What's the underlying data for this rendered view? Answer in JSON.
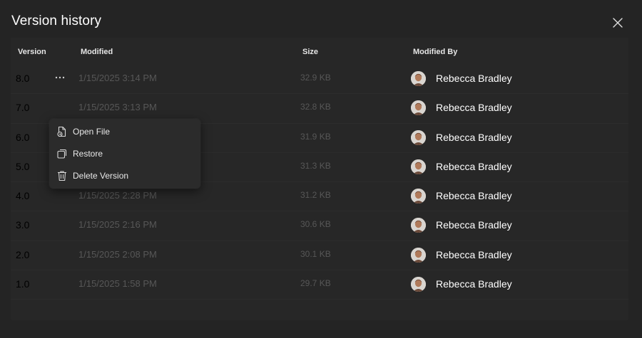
{
  "dialog": {
    "title": "Version history",
    "close_icon": "close-icon"
  },
  "table": {
    "columns": {
      "version": "Version",
      "modified": "Modified",
      "size": "Size",
      "modified_by": "Modified By"
    },
    "rows": [
      {
        "version": "8.0",
        "modified": "1/15/2025 3:14 PM",
        "size": "32.9 KB",
        "modified_by": "Rebecca Bradley"
      },
      {
        "version": "7.0",
        "modified": "1/15/2025 3:13 PM",
        "size": "32.8 KB",
        "modified_by": "Rebecca Bradley"
      },
      {
        "version": "6.0",
        "modified": "",
        "size": "31.9 KB",
        "modified_by": "Rebecca Bradley"
      },
      {
        "version": "5.0",
        "modified": "",
        "size": "31.3 KB",
        "modified_by": "Rebecca Bradley"
      },
      {
        "version": "4.0",
        "modified": "1/15/2025 2:28 PM",
        "size": "31.2 KB",
        "modified_by": "Rebecca Bradley"
      },
      {
        "version": "3.0",
        "modified": "1/15/2025 2:16 PM",
        "size": "30.6 KB",
        "modified_by": "Rebecca Bradley"
      },
      {
        "version": "2.0",
        "modified": "1/15/2025 2:08 PM",
        "size": "30.1 KB",
        "modified_by": "Rebecca Bradley"
      },
      {
        "version": "1.0",
        "modified": "1/15/2025 1:58 PM",
        "size": "29.7 KB",
        "modified_by": "Rebecca Bradley"
      }
    ],
    "more_icon": "more-horizontal-icon"
  },
  "context_menu": {
    "items": [
      {
        "label": "Open File",
        "icon": "open-file-icon"
      },
      {
        "label": "Restore",
        "icon": "restore-icon"
      },
      {
        "label": "Delete Version",
        "icon": "trash-icon"
      }
    ]
  },
  "colors": {
    "background": "#242424",
    "panel": "#272727",
    "menu": "#2b2b2b",
    "text_primary": "#ffffff",
    "text_dim": "#575757",
    "version_text": "#000000"
  }
}
